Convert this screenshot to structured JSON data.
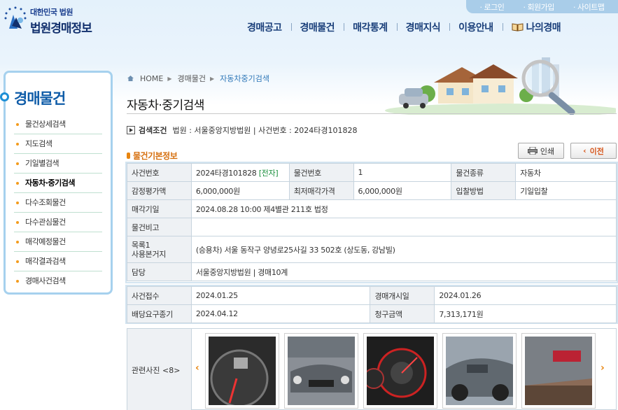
{
  "header": {
    "logo_sub": "대한민국 법원",
    "logo_main": "법원경매정보",
    "util_links": [
      "로그인",
      "회원가입",
      "사이트맵"
    ],
    "gnb": [
      "경매공고",
      "경매물건",
      "매각통계",
      "경매지식",
      "이용안내",
      "나의경매"
    ]
  },
  "sidebar": {
    "title": "경매물건",
    "items": [
      {
        "label": "물건상세검색"
      },
      {
        "label": "지도검색"
      },
      {
        "label": "기일별검색"
      },
      {
        "label": "자동차·중기검색"
      },
      {
        "label": "다수조회물건"
      },
      {
        "label": "다수관심물건"
      },
      {
        "label": "매각예정물건"
      },
      {
        "label": "매각결과검색"
      },
      {
        "label": "경매사건검색"
      }
    ]
  },
  "breadcrumb": [
    "HOME",
    "경매물건",
    "자동차중기검색"
  ],
  "page_title": "자동차·중기검색",
  "search_condition": {
    "label": "검색조건",
    "text": "법원 : 서울중앙지방법원 | 사건번호 : 2024타경101828"
  },
  "section_title": "물건기본정보",
  "buttons": {
    "print": "인쇄",
    "prev": "이전"
  },
  "basic_info": {
    "case_no_label": "사건번호",
    "case_no": "2024타경101828",
    "case_tag": "[전자]",
    "item_no_label": "물건번호",
    "item_no": "1",
    "item_type_label": "물건종류",
    "item_type": "자동차",
    "appraisal_label": "감정평가액",
    "appraisal": "6,000,000원",
    "min_price_label": "최저매각가격",
    "min_price": "6,000,000원",
    "bid_method_label": "입찰방법",
    "bid_method": "기일입찰",
    "sale_date_label": "매각기일",
    "sale_date": "2024.08.28 10:00 제4별관 211호 법정",
    "remarks_label": "물건비고",
    "remarks": "",
    "list_label_1": "목록1",
    "list_label_2": "사용본거지",
    "list_value": "(승용차) 서울 동작구 양녕로25사길 33 502호 (상도동, 강남빌)",
    "dept_label": "담당",
    "dept": "서울중앙지방법원 | 경매10계"
  },
  "case_info": {
    "received_label": "사건접수",
    "received": "2024.01.25",
    "start_label": "경매개시일",
    "start": "2024.01.26",
    "deadline_label": "배당요구종기",
    "deadline": "2024.04.12",
    "claim_label": "청구금액",
    "claim": "7,313,171원"
  },
  "photos": {
    "label": "관련사진 <8>"
  },
  "colors": {
    "brand": "#12306d",
    "accent": "#e8850f",
    "link": "#2f77b8",
    "e_tag": "#1a8f3c"
  }
}
